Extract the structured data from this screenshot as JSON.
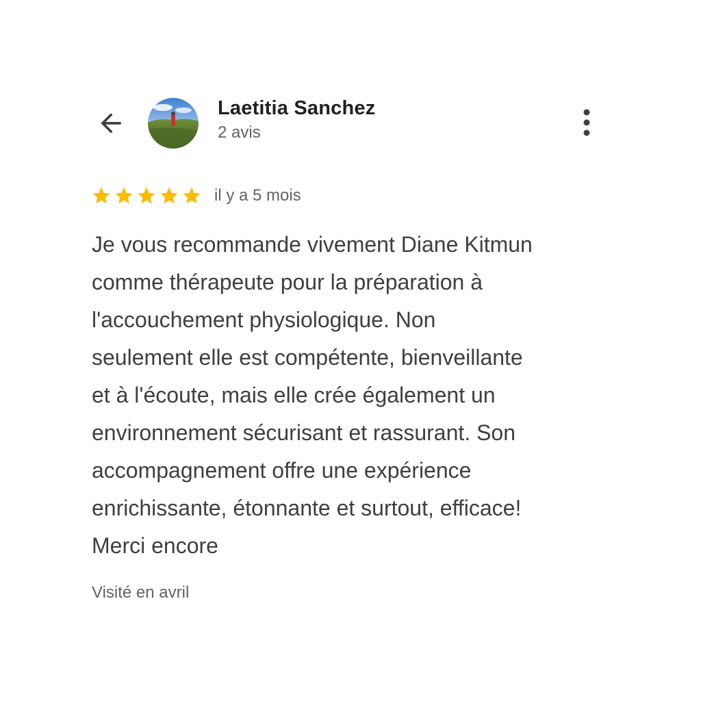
{
  "header": {
    "back_icon": "arrow-left-icon",
    "avatar_icon": "user-photo-avatar",
    "author_name": "Laetitia Sanchez",
    "author_meta": "2 avis",
    "menu_icon": "more-vert-icon"
  },
  "review": {
    "rating": 5,
    "rating_max": 5,
    "star_color": "#fbbc04",
    "date": "il y a 5 mois",
    "text_lines": [
      "Je vous recommande vivement Diane Kitmun",
      "comme thérapeute pour la préparation à",
      "l'accouchement physiologique. Non",
      "seulement elle est compétente, bienveillante",
      "et à l'écoute, mais elle crée également un",
      "environnement sécurisant et rassurant. Son",
      "accompagnement offre une expérience",
      "enrichissante, étonnante et surtout, efficace!",
      "Merci encore"
    ],
    "visit": "Visité en avril"
  }
}
